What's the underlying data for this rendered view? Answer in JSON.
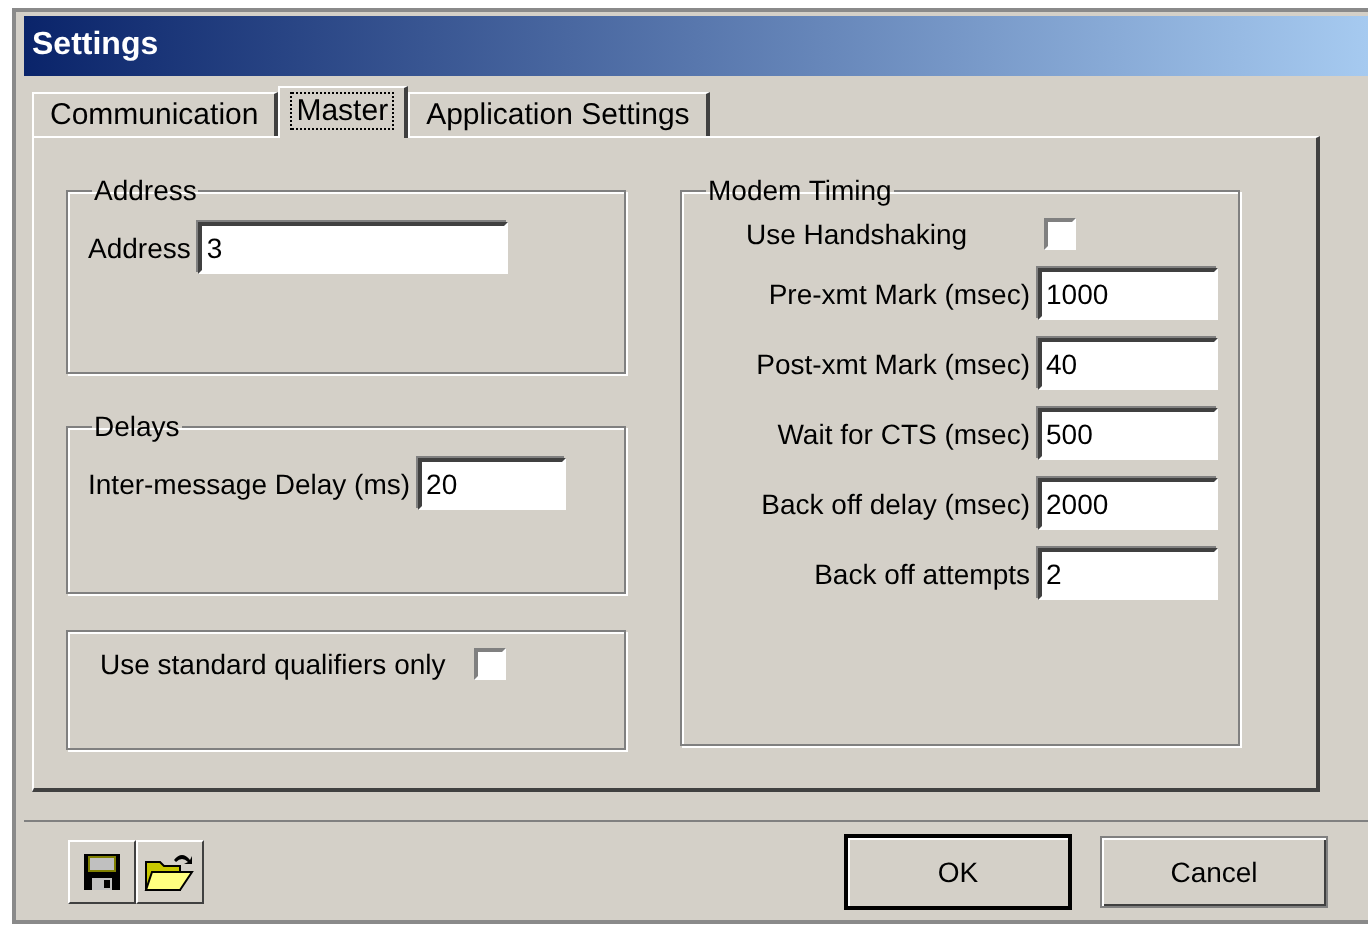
{
  "window": {
    "title": "Settings"
  },
  "tabs": [
    {
      "label": "Communication",
      "selected": false
    },
    {
      "label": "Master",
      "selected": true
    },
    {
      "label": "Application Settings",
      "selected": false
    }
  ],
  "left_groups": [
    {
      "title": "Address",
      "rows": [
        {
          "kind": "field",
          "label": "Address",
          "value": "3"
        }
      ]
    },
    {
      "title": "Delays",
      "rows": [
        {
          "kind": "field",
          "label": "Inter-message Delay (ms)",
          "value": "20"
        }
      ]
    },
    {
      "rows": [
        {
          "kind": "checkbox",
          "label": "Use standard qualifiers only",
          "checked": false
        }
      ]
    }
  ],
  "modem_timing": {
    "title": "Modem Timing",
    "rows": [
      {
        "kind": "checkbox",
        "label": "Use Handshaking",
        "checked": false
      },
      {
        "kind": "field",
        "label": "Pre-xmt Mark (msec)",
        "value": "1000"
      },
      {
        "kind": "field",
        "label": "Post-xmt Mark (msec)",
        "value": "40"
      },
      {
        "kind": "field",
        "label": "Wait for CTS (msec)",
        "value": "500"
      },
      {
        "kind": "field",
        "label": "Back off delay (msec)",
        "value": "2000"
      },
      {
        "kind": "field",
        "label": "Back off attempts",
        "value": "2"
      }
    ]
  },
  "buttons": [
    {
      "label": "OK",
      "default": true
    },
    {
      "label": "Cancel",
      "default": false
    }
  ]
}
